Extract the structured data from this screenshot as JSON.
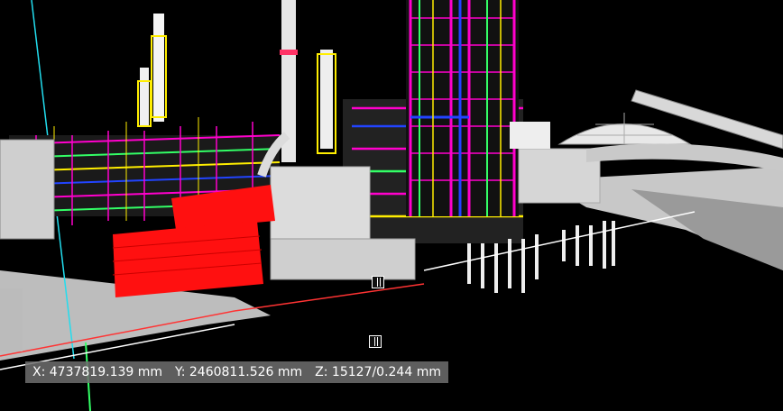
{
  "viewer": {
    "coordinates": {
      "x_label": "X:",
      "x_value": "4737819.139 mm",
      "y_label": "Y:",
      "y_value": "2460811.526 mm",
      "z_label": "Z:",
      "z_value": "15127/0.244 mm"
    },
    "colors": {
      "background": "#000000",
      "steel_magenta": "#ff00cc",
      "pipe_green": "#33ff66",
      "pipe_yellow": "#ffee00",
      "pipe_blue": "#2244ff",
      "equipment_red": "#ff1010",
      "structure_white": "#e8e8e8",
      "ground_grey": "#bfbfbf"
    },
    "icons": [
      "snap-cursor-icon",
      "snap-cursor-icon"
    ]
  }
}
